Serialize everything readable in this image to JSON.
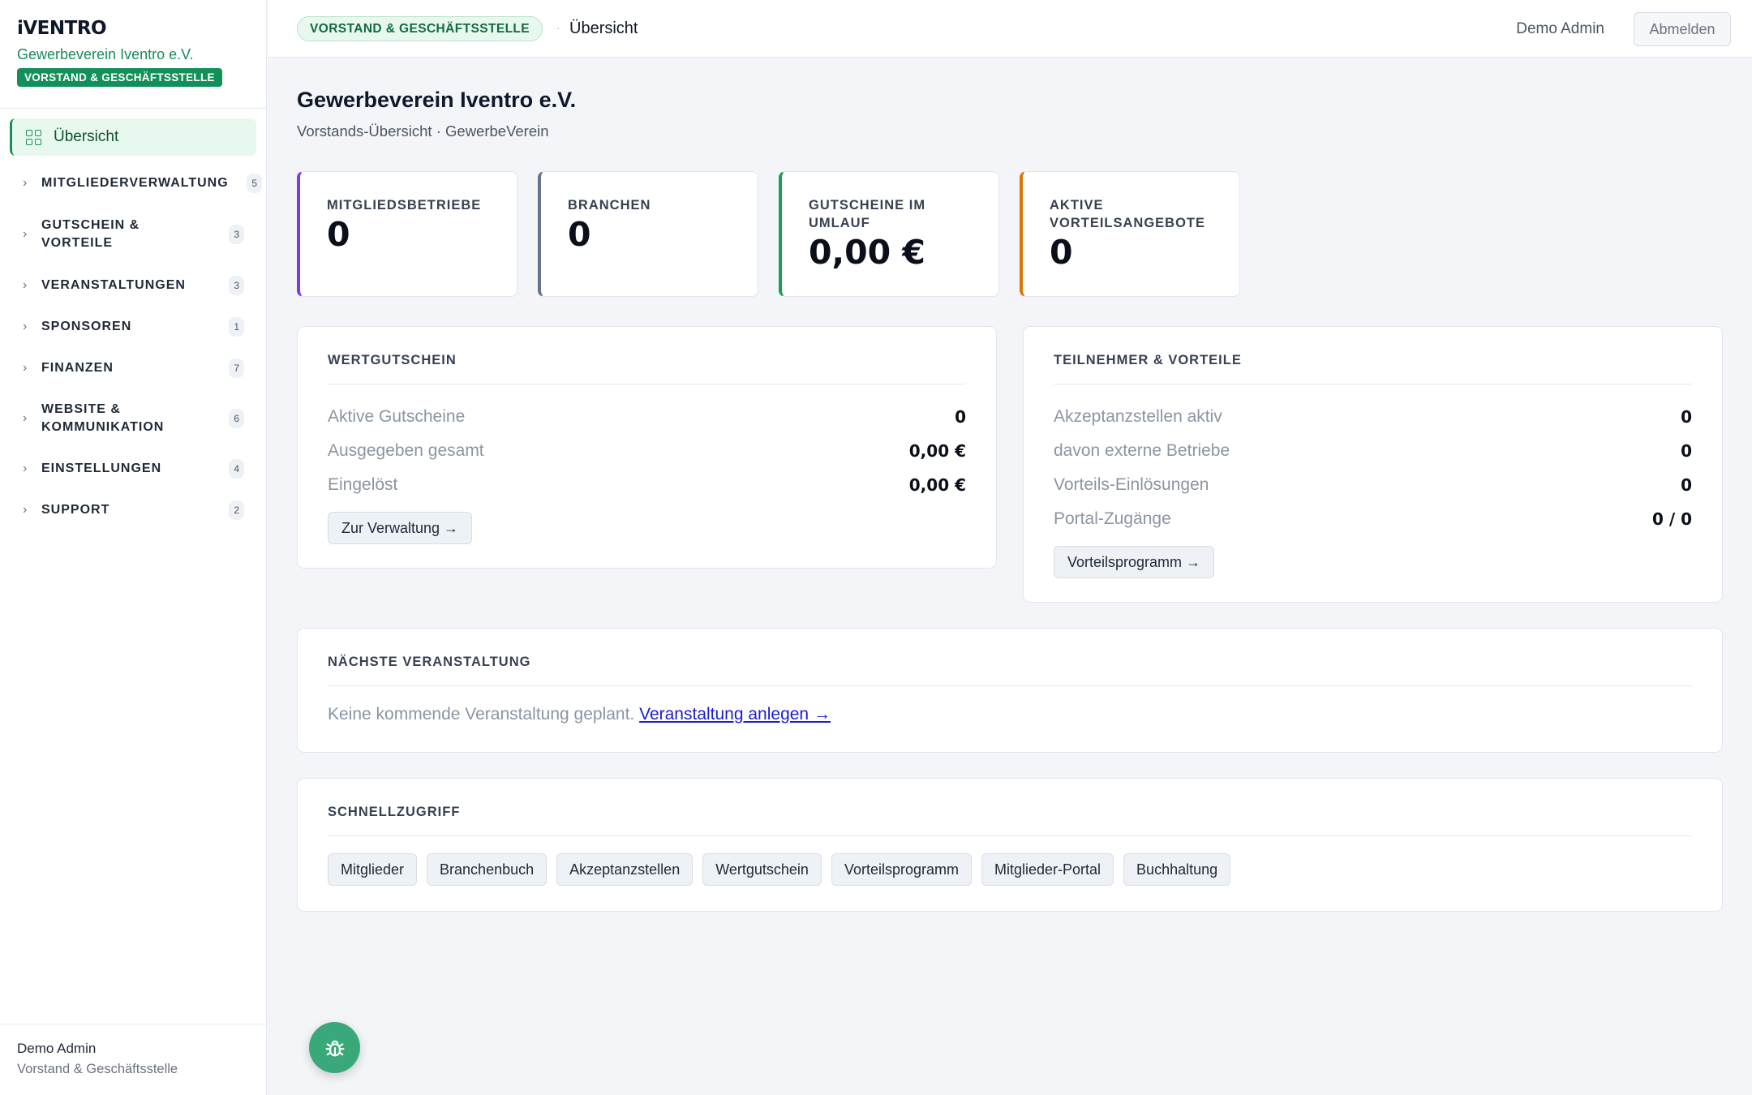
{
  "brand": {
    "logo": "iVENTRO",
    "org": "Gewerbeverein Iventro e.V.",
    "role": "VORSTAND & GESCHÄFTSSTELLE"
  },
  "nav": {
    "active": "Übersicht",
    "groups": [
      {
        "label": "MITGLIEDERVERWALTUNG",
        "count": "5"
      },
      {
        "label": "GUTSCHEIN & VORTEILE",
        "count": "3"
      },
      {
        "label": "VERANSTALTUNGEN",
        "count": "3"
      },
      {
        "label": "SPONSOREN",
        "count": "1"
      },
      {
        "label": "FINANZEN",
        "count": "7"
      },
      {
        "label": "WEBSITE & KOMMUNIKATION",
        "count": "6"
      },
      {
        "label": "EINSTELLUNGEN",
        "count": "4"
      },
      {
        "label": "SUPPORT",
        "count": "2"
      }
    ],
    "chevron": "›"
  },
  "sidebar_footer": {
    "user": "Demo Admin",
    "role": "Vorstand & Geschäftsstelle"
  },
  "topbar": {
    "role_pill": "VORSTAND & GESCHÄFTSSTELLE",
    "separator": "·",
    "title": "Übersicht",
    "user": "Demo Admin",
    "logout": "Abmelden"
  },
  "page": {
    "title": "Gewerbeverein Iventro e.V.",
    "subtitle": "Vorstands-Übersicht · GewerbeVerein"
  },
  "stats": [
    {
      "label": "MITGLIEDSBETRIEBE",
      "value": "0",
      "accent": "#7c3aed"
    },
    {
      "label": "BRANCHEN",
      "value": "0",
      "accent": "#64748b"
    },
    {
      "label": "GUTSCHEINE IM UMLAUF",
      "value": "0,00 €",
      "accent": "#16a34a"
    },
    {
      "label": "AKTIVE VORTEILSANGEBOTE",
      "value": "0",
      "accent": "#d97706"
    }
  ],
  "voucher": {
    "title": "WERTGUTSCHEIN",
    "rows": [
      {
        "k": "Aktive Gutscheine",
        "v": "0"
      },
      {
        "k": "Ausgegeben gesamt",
        "v": "0,00 €"
      },
      {
        "k": "Eingelöst",
        "v": "0,00 €"
      }
    ],
    "button": "Zur Verwaltung →"
  },
  "benefits": {
    "title": "TEILNEHMER & VORTEILE",
    "rows": [
      {
        "k": "Akzeptanzstellen aktiv",
        "v": "0"
      },
      {
        "k": "davon externe Betriebe",
        "v": "0"
      },
      {
        "k": "Vorteils-Einlösungen",
        "v": "0"
      },
      {
        "k": "Portal-Zugänge",
        "v": "0 / 0"
      }
    ],
    "button": "Vorteilsprogramm →"
  },
  "next_event": {
    "title": "NÄCHSTE VERANSTALTUNG",
    "empty_text": "Keine kommende Veranstaltung geplant.",
    "link": "Veranstaltung anlegen →"
  },
  "quick": {
    "title": "SCHNELLZUGRIFF",
    "items": [
      "Mitglieder",
      "Branchenbuch",
      "Akzeptanzstellen",
      "Wertgutschein",
      "Vorteilsprogramm",
      "Mitglieder-Portal",
      "Buchhaltung"
    ]
  },
  "fab": {
    "icon": "bug-icon"
  },
  "colors": {
    "brand_green": "#13905a",
    "link": "#1d1dd1",
    "fab": "#3aa97a"
  }
}
